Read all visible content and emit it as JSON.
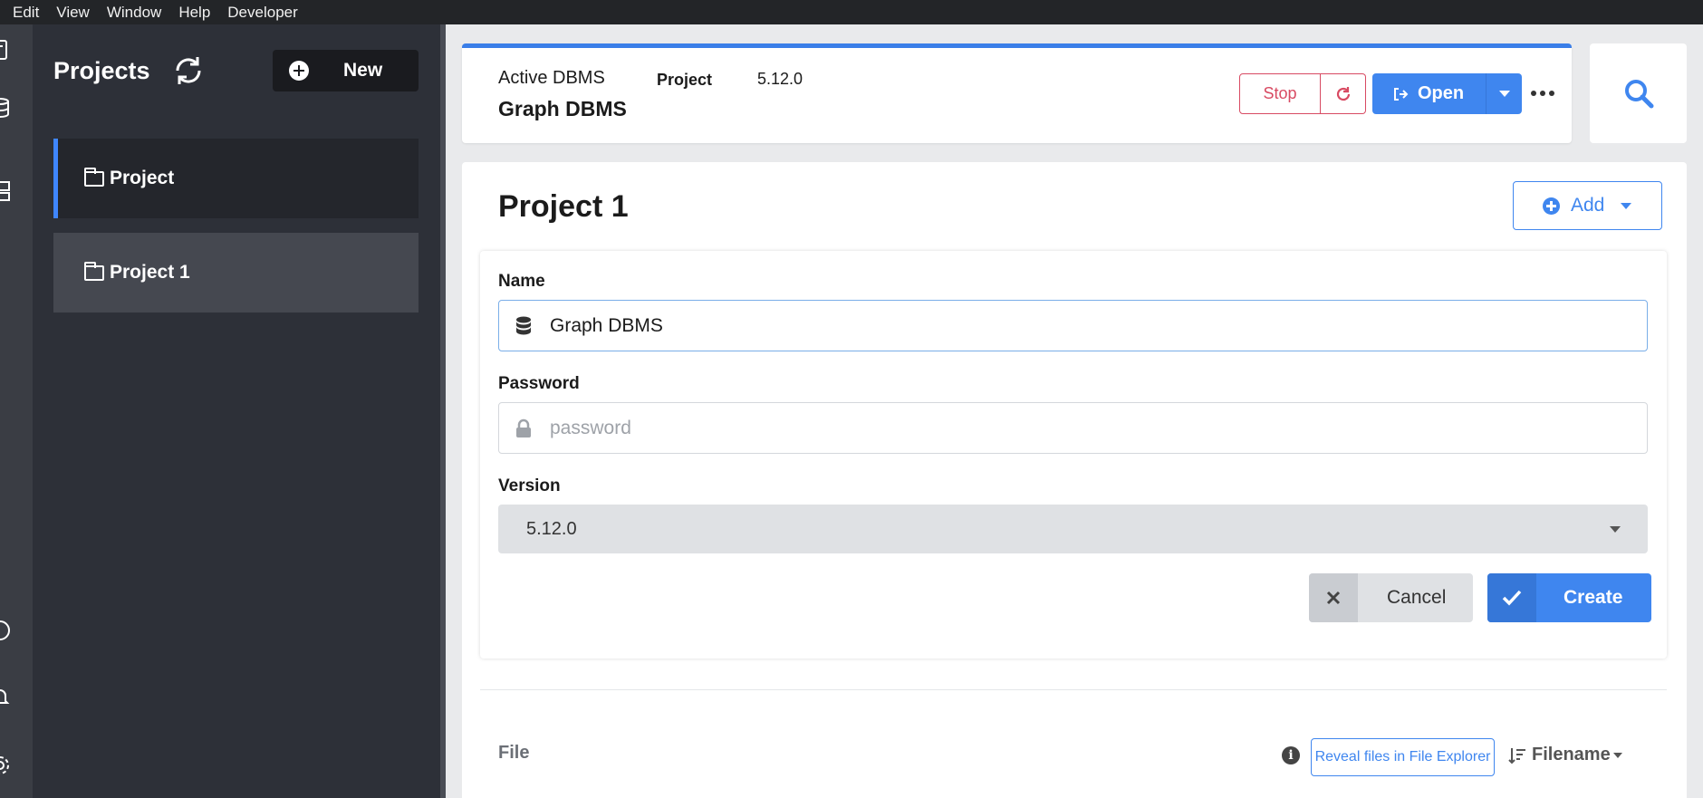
{
  "menubar": {
    "items": [
      "Edit",
      "View",
      "Window",
      "Help",
      "Developer"
    ]
  },
  "sidebar": {
    "title": "Projects",
    "new_label": "New",
    "projects": [
      {
        "label": "Project",
        "active": true
      },
      {
        "label": "Project 1",
        "active": false
      }
    ]
  },
  "active_dbms": {
    "label": "Active DBMS",
    "name": "Graph DBMS",
    "project_label": "Project",
    "version": "5.12.0",
    "stop_label": "Stop",
    "open_label": "Open"
  },
  "main": {
    "title": "Project 1",
    "add_label": "Add",
    "form": {
      "name_label": "Name",
      "name_value": "Graph DBMS",
      "password_label": "Password",
      "password_placeholder": "password",
      "version_label": "Version",
      "version_value": "5.12.0",
      "cancel_label": "Cancel",
      "create_label": "Create"
    },
    "files": {
      "label": "File",
      "reveal_label": "Reveal files in File Explorer",
      "sort_label": "Filename"
    }
  },
  "colors": {
    "accent": "#3f86ef",
    "danger": "#d84a62",
    "sidebar_bg": "#2d3038"
  }
}
